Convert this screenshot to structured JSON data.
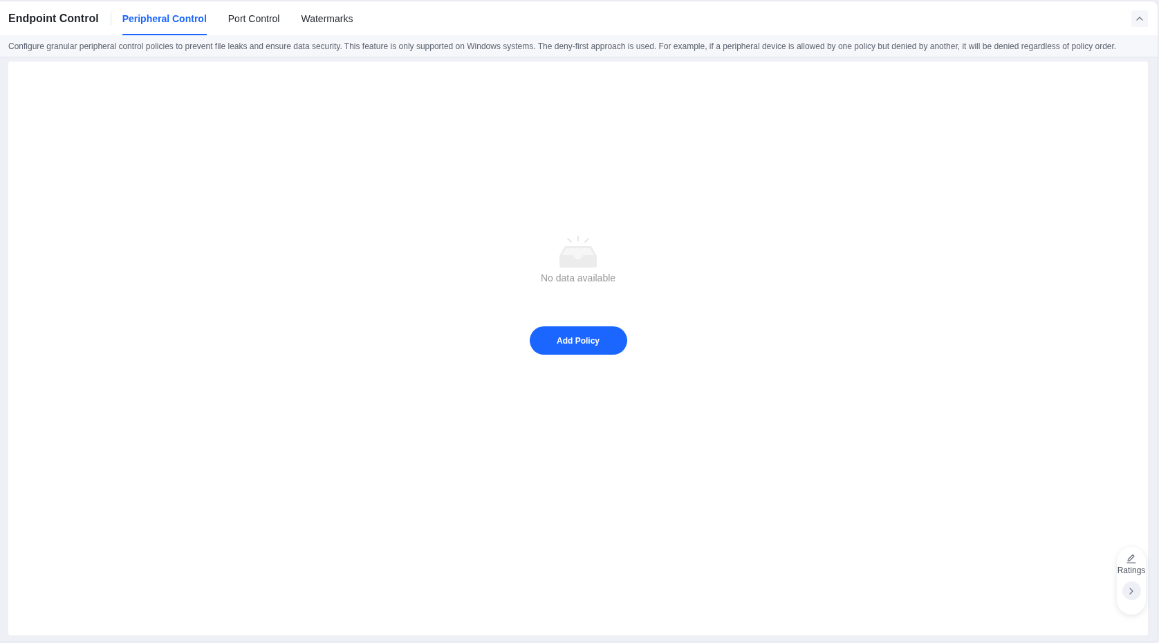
{
  "header": {
    "title": "Endpoint Control",
    "tabs": [
      {
        "label": "Peripheral Control",
        "selected": true
      },
      {
        "label": "Port Control",
        "selected": false
      },
      {
        "label": "Watermarks",
        "selected": false
      }
    ]
  },
  "description": "Configure granular peripheral control policies to prevent file leaks and ensure data security. This feature is only supported on Windows systems. The deny-first approach is used. For example, if a peripheral device is allowed by one policy but denied by another, it will be denied regardless of policy order.",
  "empty_state": {
    "message": "No data available",
    "button": "Add Policy"
  },
  "ratings_widget": {
    "label": "Ratings"
  }
}
